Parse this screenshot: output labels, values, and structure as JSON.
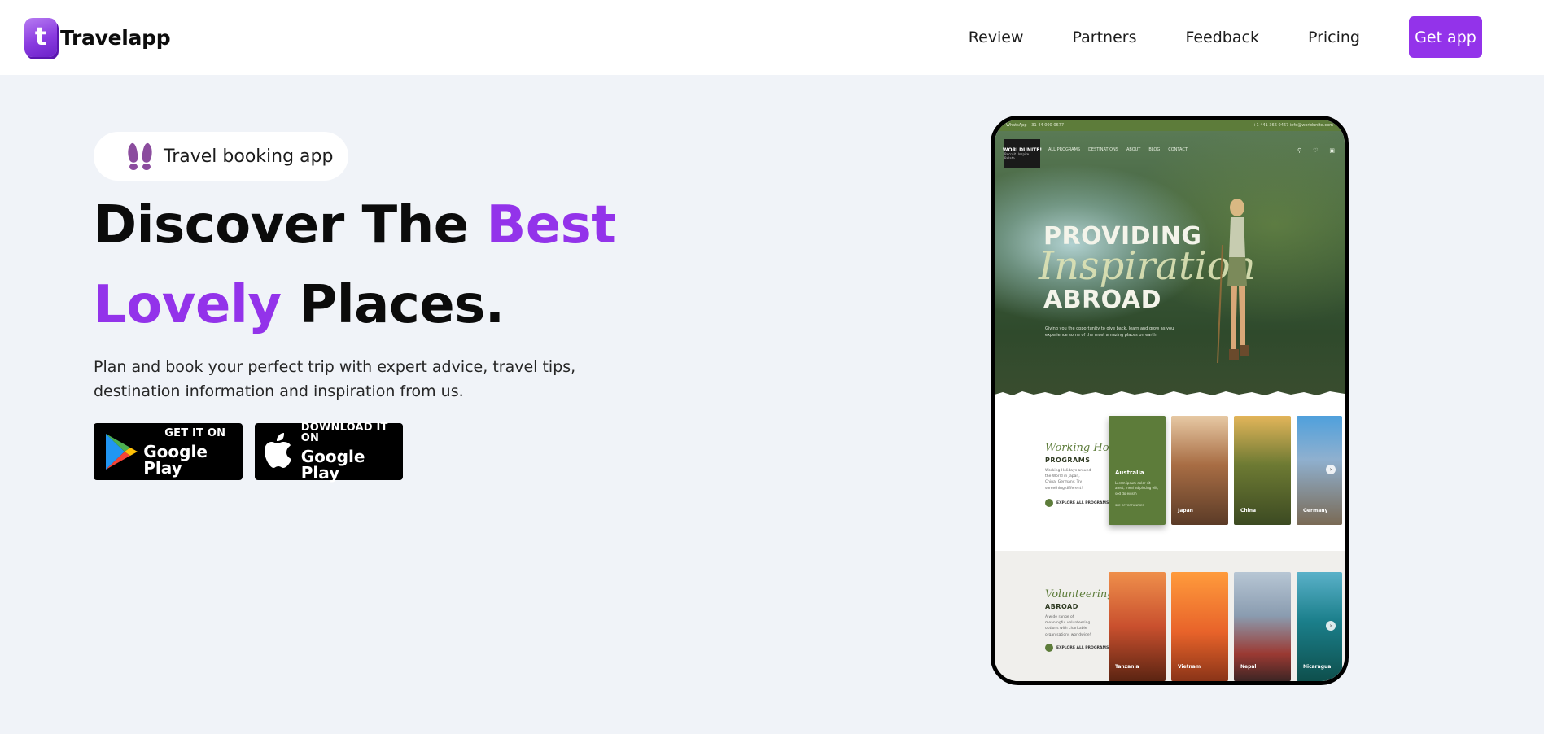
{
  "brand": {
    "logo_letter": "t",
    "name": "Travelapp",
    "color": "#9333ea"
  },
  "nav": {
    "items": [
      {
        "label": "Review"
      },
      {
        "label": "Partners"
      },
      {
        "label": "Feedback"
      },
      {
        "label": "Pricing"
      }
    ],
    "cta": "Get app"
  },
  "hero": {
    "badge": {
      "icon": "footprints-icon",
      "label": "Travel booking app"
    },
    "title": {
      "part1": "Discover The ",
      "accent1": "Best",
      "accent2": "Lovely",
      "part2": " Places."
    },
    "description": "Plan and book your perfect trip with expert advice, travel tips, destination information and inspiration from us.",
    "buttons": [
      {
        "icon": "google-play-icon",
        "small": "GET IT ON",
        "big": "Google Play"
      },
      {
        "icon": "apple-icon",
        "small": "DOWNLOAD IT ON",
        "big": "Google Play"
      }
    ]
  },
  "mockup": {
    "topbar_left": "WhatsApp +31 44 000 0677",
    "topbar_right": "+1 441 366 0467   info@worldunite.com",
    "site_logo": "WORLDUNITE!",
    "site_logo_sub": "Recruit. Inspire. Relate.",
    "site_menu": [
      "ALL PROGRAMS",
      "DESTINATIONS",
      "ABOUT",
      "BLOG",
      "CONTACT"
    ],
    "hero_line1": "PROVIDING",
    "hero_line2": "Inspiration",
    "hero_line3": "ABROAD",
    "hero_caption": "Giving you the opportunity to give back, learn and grow as you experience some of the most amazing places on earth.",
    "section1": {
      "script": "Working Holiday",
      "heading": "PROGRAMS",
      "desc": "Working Holidays around the World in Japan, China, Germany. Try something different!",
      "link": "EXPLORE ALL PROGRAMS",
      "featured": {
        "label": "Australia",
        "text": "Lorem ipsum dolor sit amet, meal adipiscing elit, sed do eiusm",
        "more": "SEE OPPORTUNITIES"
      },
      "cards": [
        "Japan",
        "China",
        "Germany"
      ]
    },
    "section2": {
      "script": "Volunteering",
      "heading": "ABROAD",
      "desc": "A wide range of meaningful volunteering options with charitable organisations worldwide!",
      "link": "EXPLORE ALL PROGRAMS",
      "cards": [
        "Tanzania",
        "Vietnam",
        "Nepal",
        "Nicaragua"
      ]
    }
  }
}
